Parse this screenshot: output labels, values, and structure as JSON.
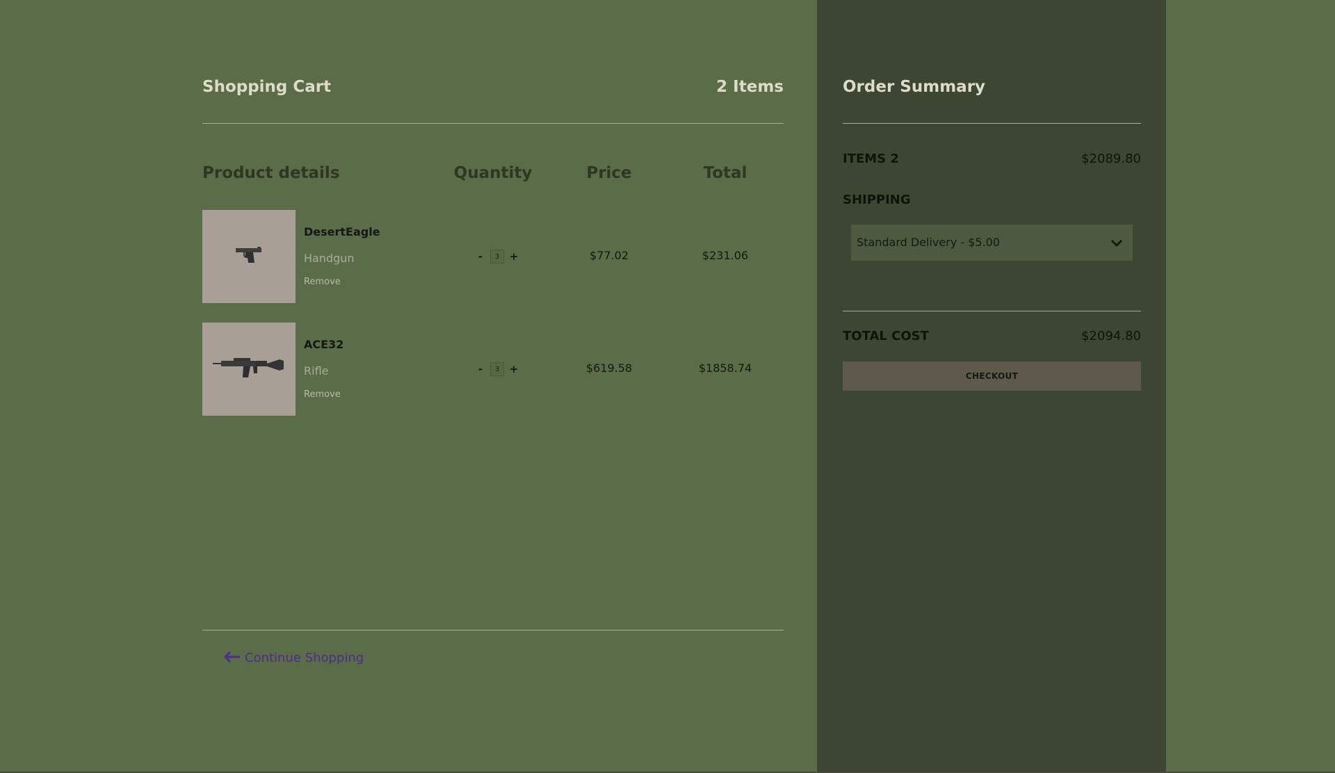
{
  "cart": {
    "title": "Shopping Cart",
    "item_count": "2 Items",
    "columns": {
      "product": "Product details",
      "quantity": "Quantity",
      "price": "Price",
      "total": "Total"
    },
    "items": [
      {
        "name": "DesertEagle",
        "category": "Handgun",
        "remove": "Remove",
        "qty_minus": "-",
        "quantity": "3",
        "qty_plus": "+",
        "price": "$77.02",
        "total": "$231.06",
        "image_icon": "handgun-icon"
      },
      {
        "name": "ACE32",
        "category": "Rifle",
        "remove": "Remove",
        "qty_minus": "-",
        "quantity": "3",
        "qty_plus": "+",
        "price": "$619.58",
        "total": "$1858.74",
        "image_icon": "rifle-icon"
      }
    ],
    "continue_label": "Continue Shopping"
  },
  "summary": {
    "title": "Order Summary",
    "items_label": "ITEMS 2",
    "items_value": "$2089.80",
    "shipping_label": "SHIPPING",
    "shipping_selected": "Standard Delivery - $5.00",
    "total_label": "TOTAL COST",
    "total_value": "$2094.80",
    "checkout_label": "CHECKOUT"
  },
  "colors": {
    "page_bg": "#5b6c48",
    "summary_bg": "#3d4633",
    "thumb_bg": "#a89f96",
    "link": "#4d2c8c",
    "checkout_bg": "#5d5a4c"
  }
}
